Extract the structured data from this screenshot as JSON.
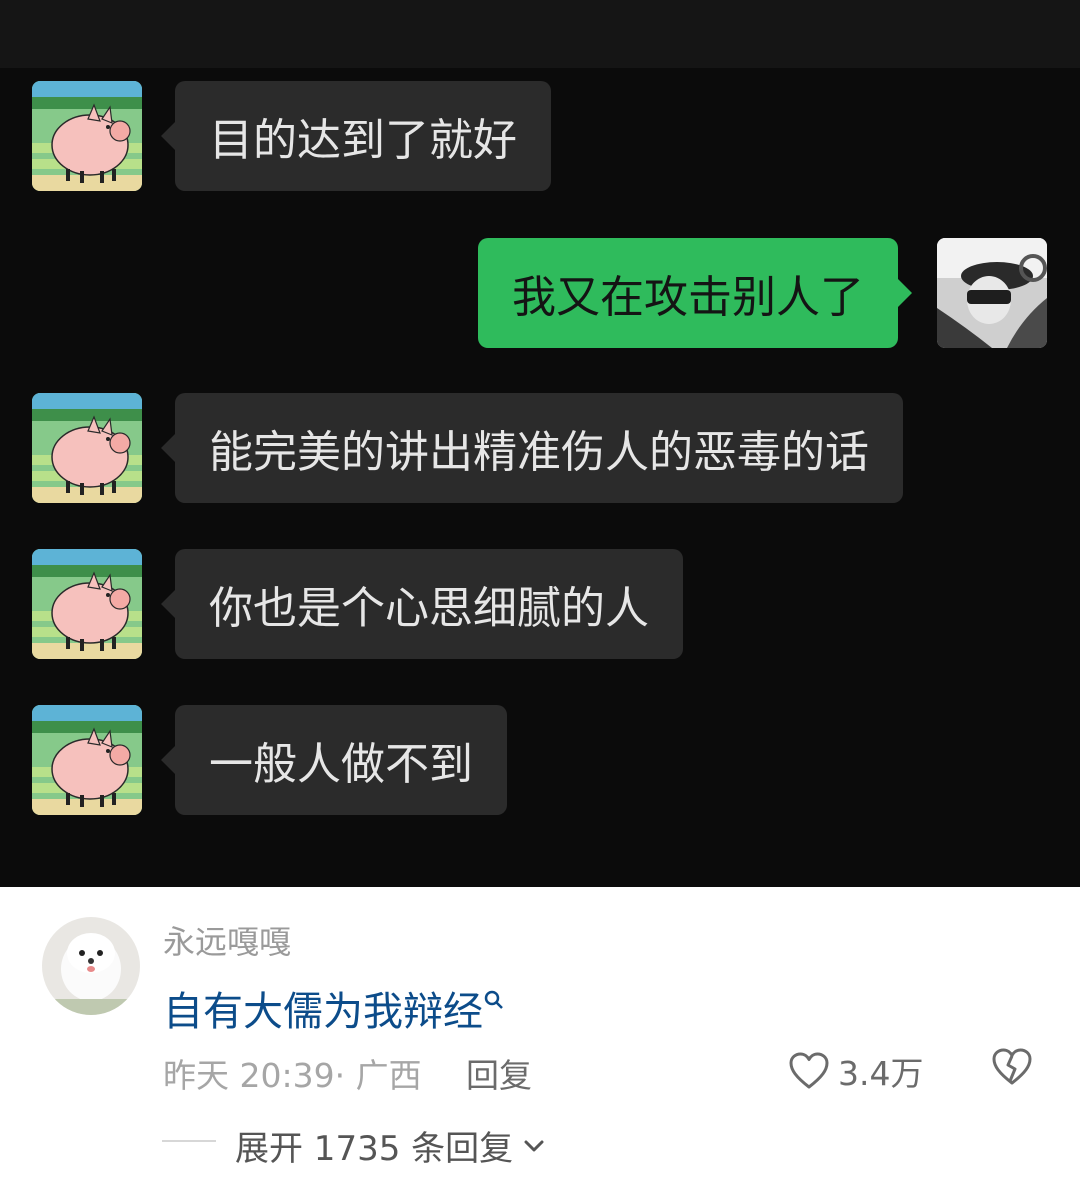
{
  "messages": [
    {
      "side": "left",
      "text": "目的达到了就好"
    },
    {
      "side": "right",
      "text": "我又在攻击别人了"
    },
    {
      "side": "left",
      "text": "能完美的讲出精准伤人的恶毒的话"
    },
    {
      "side": "left",
      "text": "你也是个心思细腻的人"
    },
    {
      "side": "left",
      "text": "一般人做不到"
    }
  ],
  "comment": {
    "username": "永远嘎嘎",
    "text": "自有大儒为我辩经",
    "search_hint_icon": "search-icon",
    "time": "昨天 20:39",
    "location": "· 广西",
    "reply_label": "回复",
    "likes": "3.4万",
    "expand_label": "展开 1735 条回复"
  },
  "colors": {
    "chat_bg": "#0b0b0b",
    "bubble_left": "#2b2b2b",
    "bubble_right": "#2fbb5c",
    "comment_text": "#0c4c8a"
  }
}
